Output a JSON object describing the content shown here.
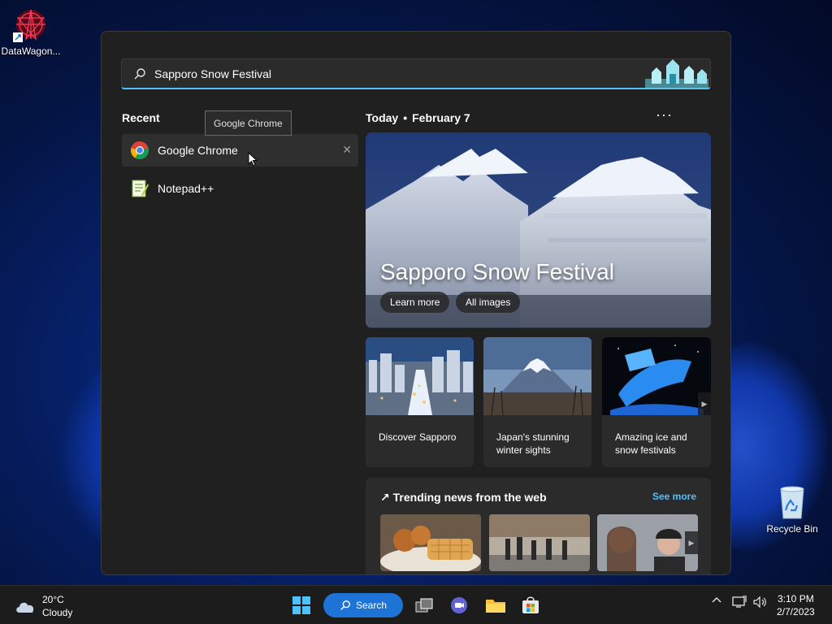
{
  "desktop": {
    "icons": [
      {
        "label": "DataWagon..."
      },
      {
        "label": "Recycle Bin"
      }
    ]
  },
  "search": {
    "query": "Sapporo Snow Festival",
    "accent": "#4cc2ff"
  },
  "recent": {
    "title": "Recent",
    "items": [
      {
        "label": "Google Chrome",
        "icon": "chrome-icon"
      },
      {
        "label": "Notepad++",
        "icon": "notepadpp-icon"
      }
    ],
    "tooltip": "Google Chrome"
  },
  "today": {
    "label": "Today",
    "date": "February 7",
    "more": "···"
  },
  "hero": {
    "title": "Sapporo Snow Festival",
    "learn_more": "Learn more",
    "all_images": "All images"
  },
  "cards": [
    {
      "caption": "Discover Sapporo"
    },
    {
      "caption": "Japan's stunning winter sights"
    },
    {
      "caption": "Amazing ice and snow festivals"
    }
  ],
  "trending": {
    "title": "Trending news from the web",
    "see_more": "See more"
  },
  "taskbar": {
    "weather_temp": "20°C",
    "weather_cond": "Cloudy",
    "search_label": "Search",
    "time": "3:10 PM",
    "date": "2/7/2023",
    "accent": "#1e73d6"
  }
}
